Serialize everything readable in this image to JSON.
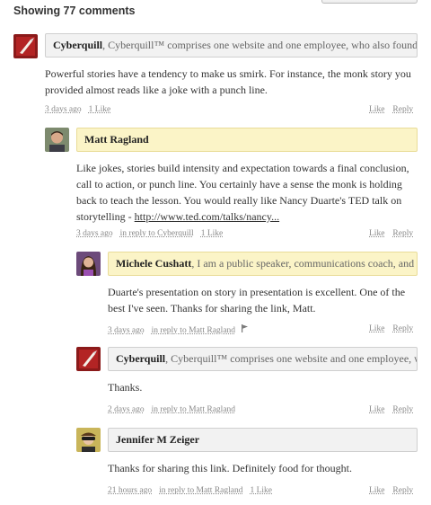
{
  "header": {
    "title": "Showing 77 comments"
  },
  "comments": [
    {
      "author": "Cyberquill",
      "bio": ", Cyberquill™ comprises one website and one employee, who also founded the ...",
      "body": "Powerful stories have a tendency to make us smirk. For instance, the monk story you provided almost reads like a joke with a punch line.",
      "time": "3 days ago",
      "likes": "1 Like",
      "like_label": "Like",
      "reply_label": "Reply"
    },
    {
      "author": "Matt Ragland",
      "bio": "",
      "body": "Like jokes, stories build intensity and expectation towards a final conclusion, call to action, or punch line. You certainly have a sense the monk is holding back to teach the lesson. You would really like Nancy Duarte's TED talk on storytelling - ",
      "body_link": "http://www.ted.com/talks/nancy...",
      "time": "3 days ago",
      "in_reply_to": "in reply to Cyberquill",
      "likes": "1 Like",
      "like_label": "Like",
      "reply_label": "Reply"
    },
    {
      "author": "Michele Cushatt",
      "bio": ", I am a public speaker, communications coach, and wr...",
      "menu": "...",
      "body": "Duarte's presentation on story in presentation is excellent. One of the best I've seen. Thanks for sharing the link, Matt.",
      "time": "3 days ago",
      "in_reply_to": "in reply to Matt Ragland",
      "like_label": "Like",
      "reply_label": "Reply"
    },
    {
      "author": "Cyberquill",
      "bio": ", Cyberquill™ comprises one website and one employee, who a...",
      "body": "Thanks.",
      "time": "2 days ago",
      "in_reply_to": "in reply to Matt Ragland",
      "like_label": "Like",
      "reply_label": "Reply"
    },
    {
      "author": "Jennifer M Zeiger",
      "bio": "",
      "body": "Thanks for sharing this link. Definitely food for thought.",
      "time": "21 hours ago",
      "in_reply_to": "in reply to Matt Ragland",
      "likes": "1 Like",
      "like_label": "Like",
      "reply_label": "Reply"
    }
  ],
  "colors": {
    "highlight": "#fbf4c7",
    "name_bar": "#f2f2f2",
    "meta_text": "#888888"
  }
}
